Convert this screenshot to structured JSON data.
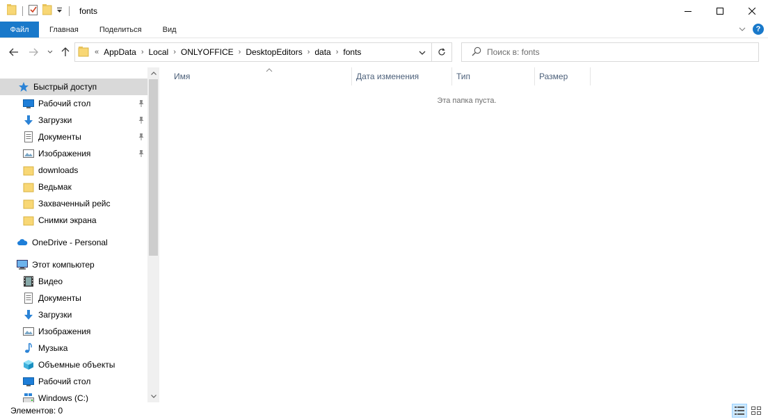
{
  "window": {
    "title": "fonts"
  },
  "ribbon": {
    "tabs": [
      {
        "label": "Файл"
      },
      {
        "label": "Главная"
      },
      {
        "label": "Поделиться"
      },
      {
        "label": "Вид"
      }
    ],
    "help": "?"
  },
  "address": {
    "overflow": "«",
    "crumbs": [
      "AppData",
      "Local",
      "ONLYOFFICE",
      "DesktopEditors",
      "data",
      "fonts"
    ],
    "separator": "›"
  },
  "search": {
    "placeholder": "Поиск в: fonts"
  },
  "sidebar": {
    "quick_access": "Быстрый доступ",
    "items": [
      {
        "label": "Рабочий стол",
        "icon": "desktop-icon",
        "pinned": true
      },
      {
        "label": "Загрузки",
        "icon": "download-icon",
        "pinned": true
      },
      {
        "label": "Документы",
        "icon": "document-icon",
        "pinned": true
      },
      {
        "label": "Изображения",
        "icon": "pictures-icon",
        "pinned": true
      },
      {
        "label": "downloads",
        "icon": "folder-icon",
        "pinned": false
      },
      {
        "label": "Ведьмак",
        "icon": "folder-icon",
        "pinned": false
      },
      {
        "label": "Захваченный рейс",
        "icon": "folder-icon",
        "pinned": false
      },
      {
        "label": "Снимки экрана",
        "icon": "folder-icon",
        "pinned": false
      }
    ],
    "onedrive": "OneDrive - Personal",
    "this_pc": "Этот компьютер",
    "pc_items": [
      {
        "label": "Видео",
        "icon": "video-icon"
      },
      {
        "label": "Документы",
        "icon": "document-icon"
      },
      {
        "label": "Загрузки",
        "icon": "download-icon"
      },
      {
        "label": "Изображения",
        "icon": "pictures-icon"
      },
      {
        "label": "Музыка",
        "icon": "music-icon"
      },
      {
        "label": "Объемные объекты",
        "icon": "3d-objects-icon"
      },
      {
        "label": "Рабочий стол",
        "icon": "desktop-icon"
      },
      {
        "label": "Windows (C:)",
        "icon": "drive-icon"
      }
    ]
  },
  "columns": [
    {
      "label": "Имя"
    },
    {
      "label": "Дата изменения"
    },
    {
      "label": "Тип"
    },
    {
      "label": "Размер"
    }
  ],
  "content": {
    "empty_message": "Эта папка пуста."
  },
  "status": {
    "items_count": "Элементов: 0"
  },
  "colors": {
    "accent": "#1979ca",
    "folder": "#f8d775",
    "selected": "#d9d9d9"
  }
}
